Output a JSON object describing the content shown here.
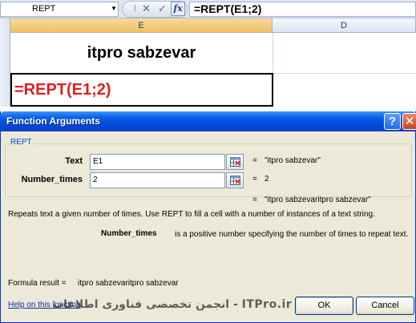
{
  "formula_bar": {
    "name_box": "REPT",
    "name_box_arrow_icon": "dropdown-arrow-icon",
    "cancel_symbol": "✕",
    "enter_symbol": "✓",
    "fx_label": "fx",
    "formula": "=REPT(E1;2)"
  },
  "sheet": {
    "columns": [
      "E",
      "D"
    ],
    "cells": {
      "E1": "itpro sabzevar",
      "E2": "=REPT(E1;2)"
    },
    "active_header_color": "#f1c15f",
    "formula_cell_color": "#e01e1e"
  },
  "dialog": {
    "title": "Function Arguments",
    "help_button": "?",
    "close_button": "✕",
    "function_name": "REPT",
    "arguments": [
      {
        "label": "Text",
        "value": "E1",
        "result": "\"itpro sabzevar\""
      },
      {
        "label": "Number_times",
        "value": "2",
        "result": "2"
      }
    ],
    "equals": "=",
    "overall_result": "\"itpro sabzevaritpro sabzevar\"",
    "description": "Repeats text a given number of times. Use REPT to fill a cell with a number of instances of a text string.",
    "param_name": "Number_times",
    "param_description": "is a positive number specifying the number of times to repeat text.",
    "formula_result_label": "Formula result =",
    "formula_result_value": "itpro sabzevaritpro sabzevar",
    "help_link": "Help on this function",
    "ok_button": "OK",
    "cancel_button": "Cancel",
    "watermark": "انجمن تخصصی فناوری اطلاعات - ITPro.ir",
    "title_bar_color": "#0548d6",
    "face_color": "#ece9d8"
  }
}
